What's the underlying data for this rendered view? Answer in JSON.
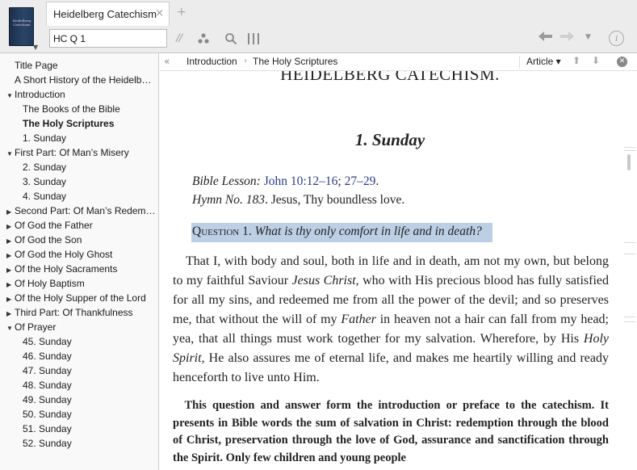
{
  "header": {
    "book_cover_text": "Heidelberg Catechism",
    "tab_title": "Heidelberg Catechism",
    "tab_close": "×",
    "new_tab": "+",
    "reference_value": "HC Q 1",
    "tools": {
      "parallel": "//",
      "visual_filter": "⁘",
      "search": "⌕",
      "columns": "|||"
    },
    "nav": {
      "back": "◀━",
      "forward": "━▶",
      "menu": "▼",
      "info": "i"
    }
  },
  "sidebar": {
    "items": [
      {
        "label": "Title Page",
        "arrow": "",
        "bold": false
      },
      {
        "label": "A Short History of the Heidelb…",
        "arrow": "",
        "bold": false
      },
      {
        "label": "Introduction",
        "arrow": "▼",
        "bold": false
      },
      {
        "label": "The Books of the Bible",
        "arrow": "",
        "bold": false
      },
      {
        "label": "The Holy Scriptures",
        "arrow": "",
        "bold": true
      },
      {
        "label": "1. Sunday",
        "arrow": "",
        "bold": false
      },
      {
        "label": "First Part: Of Man’s Misery",
        "arrow": "▼",
        "bold": false
      },
      {
        "label": "2. Sunday",
        "arrow": "",
        "bold": false
      },
      {
        "label": "3. Sunday",
        "arrow": "",
        "bold": false
      },
      {
        "label": "4. Sunday",
        "arrow": "",
        "bold": false
      },
      {
        "label": "Second Part: Of Man’s Redem…",
        "arrow": "▶",
        "bold": false
      },
      {
        "label": "Of God the Father",
        "arrow": "▶",
        "bold": false
      },
      {
        "label": "Of God the Son",
        "arrow": "▶",
        "bold": false
      },
      {
        "label": "Of God the Holy Ghost",
        "arrow": "▶",
        "bold": false
      },
      {
        "label": "Of the Holy Sacraments",
        "arrow": "▶",
        "bold": false
      },
      {
        "label": "Of Holy Baptism",
        "arrow": "▶",
        "bold": false
      },
      {
        "label": "Of the Holy Supper of the Lord",
        "arrow": "▶",
        "bold": false
      },
      {
        "label": "Third Part: Of Thankfulness",
        "arrow": "▶",
        "bold": false
      },
      {
        "label": "Of Prayer",
        "arrow": "▼",
        "bold": false
      },
      {
        "label": "45. Sunday",
        "arrow": "",
        "bold": false
      },
      {
        "label": "46. Sunday",
        "arrow": "",
        "bold": false
      },
      {
        "label": "47. Sunday",
        "arrow": "",
        "bold": false
      },
      {
        "label": "48. Sunday",
        "arrow": "",
        "bold": false
      },
      {
        "label": "49. Sunday",
        "arrow": "",
        "bold": false
      },
      {
        "label": "50. Sunday",
        "arrow": "",
        "bold": false
      },
      {
        "label": "51. Sunday",
        "arrow": "",
        "bold": false
      },
      {
        "label": "52. Sunday",
        "arrow": "",
        "bold": false
      }
    ]
  },
  "reader": {
    "collapse": "«",
    "breadcrumb": [
      "Introduction",
      "The Holy Scriptures"
    ],
    "breadcrumb_sep": "›",
    "article_label": "Article ▾",
    "up": "⬆",
    "down": "⬇",
    "close": "✕"
  },
  "content": {
    "partial_heading": "HEIDELBERG CATECHISM.",
    "sunday_heading": "1. Sunday",
    "bible_lesson_label": "Bible Lesson:",
    "bible_lesson_ref1": "John 10:12–16",
    "bible_lesson_sep": ";",
    "bible_lesson_ref2": "27–29",
    "bible_lesson_end": ".",
    "hymn_label": "Hymn No. 183",
    "hymn_text": ". Jesus, Thy boundless love.",
    "question_label": "Question 1.",
    "question_text": "What is thy only comfort in life and in death?",
    "answer_p1": "That I, with body and soul, both in life and in death, am not my own, but belong to my faithful Saviour ",
    "answer_em1": "Jesus Christ",
    "answer_p2": ", who with His precious blood has fully satisfied for all my sins, and redeemed me from all the power of the devil; and so preserves me, that without the will of my ",
    "answer_em2": "Father",
    "answer_p3": " in heaven not a hair can fall from my head; yea, that all things must work together for my salvation. Wherefore, by His ",
    "answer_em3": "Holy Spirit",
    "answer_p4": ", He also assures me of eternal life, and makes me heartily willing and ready henceforth to live unto Him.",
    "commentary": "This question and answer form the introduction or preface to the catechism. It presents in Bible words the sum of salvation in Christ: redemption through the blood of Christ, preservation through the love of God, assurance and sanctification through the Spirit. Only few children and young people"
  }
}
